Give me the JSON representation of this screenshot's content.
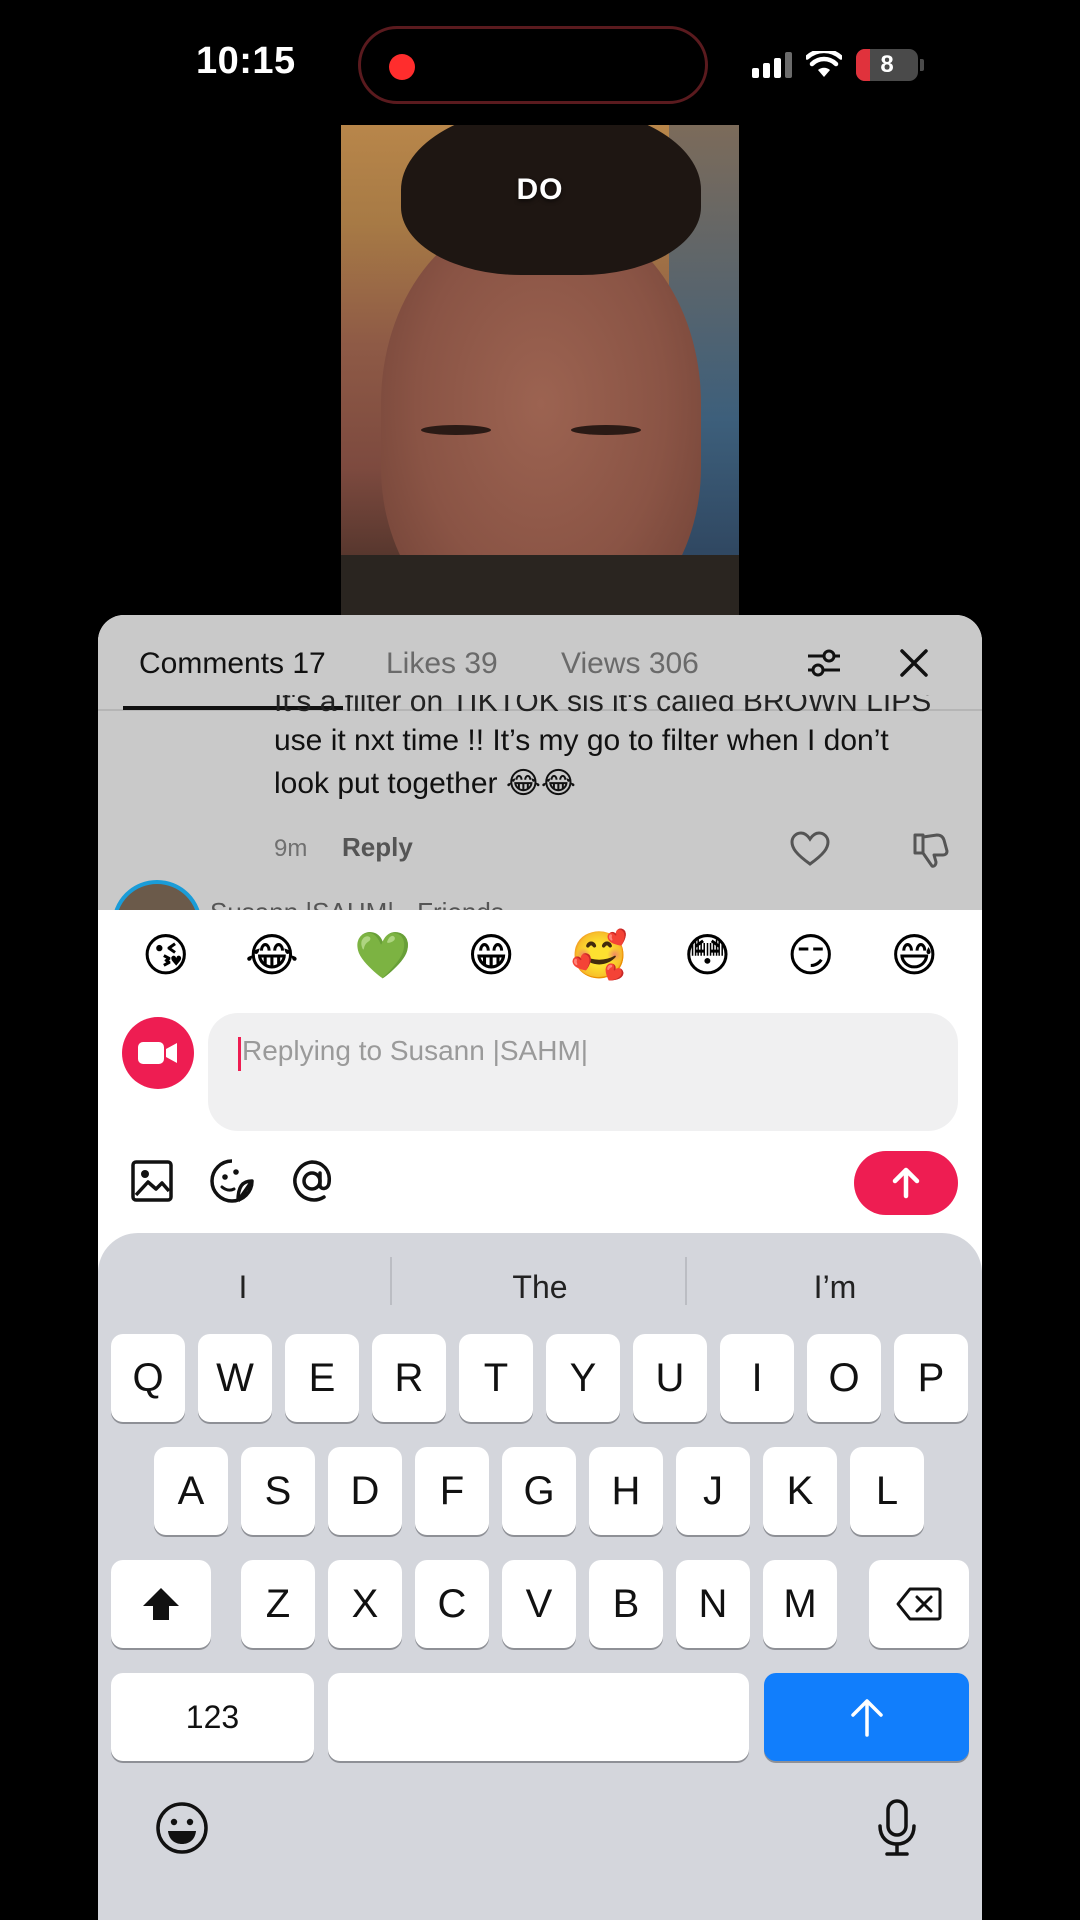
{
  "status": {
    "time": "10:15",
    "battery": "8"
  },
  "video": {
    "caption": "DO"
  },
  "tabs": {
    "comments": "Comments 17",
    "likes": "Likes 39",
    "views": "Views 306"
  },
  "comment": {
    "text_cut": "It's a filter on TIKTOK sis it's called BROWN LIPS",
    "text_line1": "use it nxt time !! It’s my go to filter when I don’t",
    "text_line2": "look put together 😂😂",
    "time": "9m",
    "reply": "Reply"
  },
  "next_comment": {
    "user": "Susann |SAHM| · Friends"
  },
  "emojis": [
    "😘",
    "😂",
    "💚",
    "😁",
    "🥰",
    "😳",
    "😏",
    "😅"
  ],
  "input": {
    "placeholder": "Replying to Susann |SAHM|"
  },
  "keyboard": {
    "suggestions": [
      "I",
      "The",
      "I’m"
    ],
    "row1": [
      "Q",
      "W",
      "E",
      "R",
      "T",
      "Y",
      "U",
      "I",
      "O",
      "P"
    ],
    "row2": [
      "A",
      "S",
      "D",
      "F",
      "G",
      "H",
      "J",
      "K",
      "L"
    ],
    "row3": [
      "Z",
      "X",
      "C",
      "V",
      "B",
      "N",
      "M"
    ],
    "numbers_key": "123"
  },
  "colors": {
    "accent": "#ee1d52",
    "return_key": "#117efc"
  }
}
